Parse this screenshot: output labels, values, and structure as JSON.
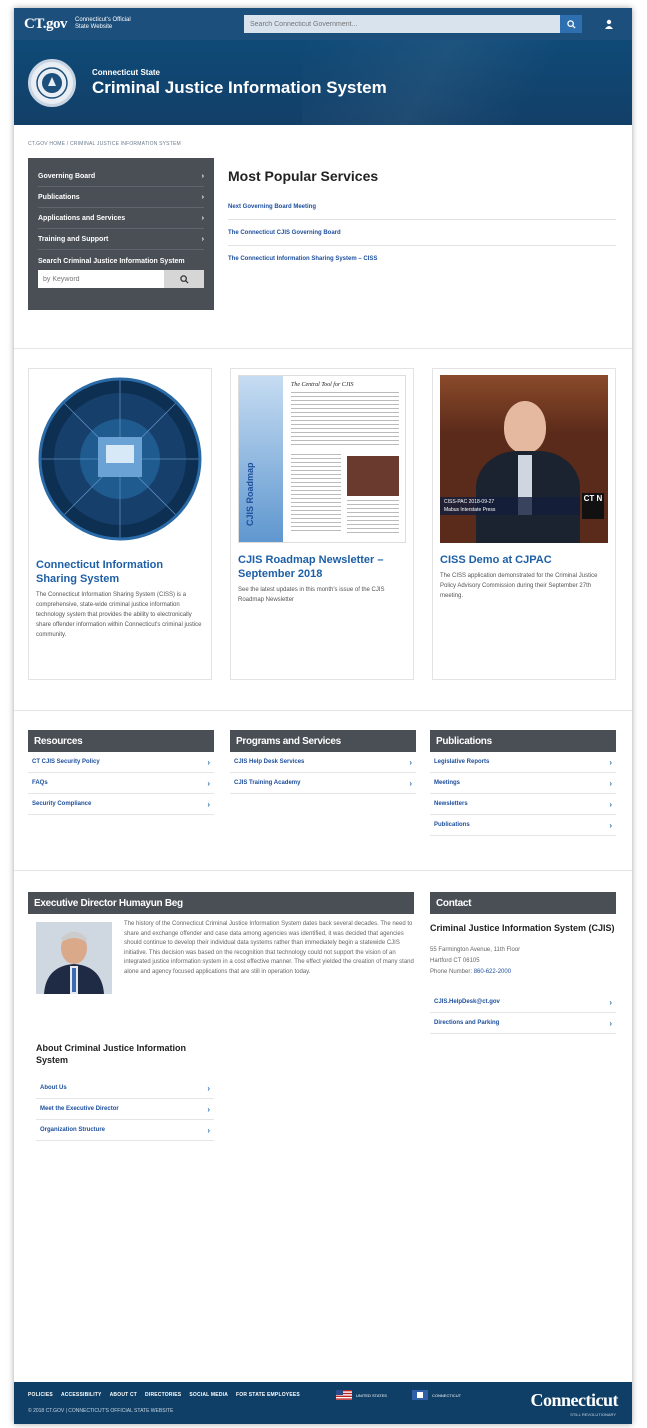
{
  "topbar": {
    "logo": "CT.gov",
    "logo_sub": "Connecticut's Official State Website",
    "search_placeholder": "Search Connecticut Government...",
    "search_icon": "search-icon",
    "user_icon": "user-icon"
  },
  "hero": {
    "agency_small": "Connecticut State",
    "agency_title": "Criminal Justice Information System"
  },
  "breadcrumb": "CT.GOV HOME  /  CRIMINAL JUSTICE INFORMATION SYSTEM",
  "sidebar": {
    "items": [
      {
        "label": "Governing Board",
        "chevron": "›"
      },
      {
        "label": "Publications",
        "chevron": "›"
      },
      {
        "label": "Applications and Services",
        "chevron": "›"
      },
      {
        "label": "Training and Support",
        "chevron": "›"
      }
    ],
    "search_label": "Search Criminal Justice Information System",
    "search_placeholder": "by Keyword",
    "search_icon": "⌕"
  },
  "popular": {
    "title": "Most Popular Services",
    "links": [
      "Next Governing Board Meeting",
      "The Connecticut CJIS Governing Board",
      "The Connecticut Information Sharing System – CISS"
    ]
  },
  "cards": [
    {
      "title": "Connecticut Information Sharing System",
      "text": "The Connecticut Information Sharing System (CISS) is a comprehensive, state-wide criminal justice information technology system that provides the ability to electronically share offender information within Connecticut's criminal justice community."
    },
    {
      "title": "CJIS Roadmap Newsletter – September 2018",
      "text": "See the latest updates in this month's issue of the CJIS Roadmap Newsletter"
    },
    {
      "title": "CISS Demo at CJPAC",
      "text": "The CISS application demonstrated for the Criminal Justice Policy Advisory Commission during their September 27th meeting."
    }
  ],
  "card_images": {
    "newsletter_heading": "The Central Tool for CJIS",
    "newsletter_spine": "CJIS Roadmap",
    "video_caption_1": "CISS-PAC  2018-09-27",
    "video_caption_2": "Mabus Interstate Press",
    "video_badge": "CT N"
  },
  "lists": [
    {
      "head": "Resources",
      "links": [
        "CT CJIS Security Policy",
        "FAQs",
        "Security Compliance"
      ]
    },
    {
      "head": "Programs and Services",
      "links": [
        "CJIS Help Desk Services",
        "CJIS Training Academy"
      ]
    },
    {
      "head": "Publications",
      "links": [
        "Legislative Reports",
        "Meetings",
        "Newsletters",
        "Publications"
      ]
    }
  ],
  "executive": {
    "head": "Executive Director Humayun Beg",
    "text": "The history of the Connecticut Criminal Justice Information System dates back several decades. The need to share and exchange offender and case data among agencies was identified, it was decided that agencies should continue to develop their individual data systems rather than immediately begin a statewide CJIS initiative. This decision was based on the recognition that technology could not support the vision of an integrated justice information system in a cost effective manner. The effect yielded the creation of many stand alone and agency focused applications that are still in operation today.",
    "about_title": "About Criminal Justice Information System",
    "about_links": [
      "About Us",
      "Meet the Executive Director",
      "Organization Structure"
    ]
  },
  "contact": {
    "head": "Contact",
    "title": "Criminal Justice Information System (CJIS)",
    "address_1": "55 Farmington Avenue, 11th Floor",
    "address_2": "Hartford CT 06105",
    "phone_label": "Phone Number:",
    "phone": "860-622-2000",
    "links": [
      "CJIS.HelpDesk@ct.gov",
      "Directions and Parking"
    ]
  },
  "footer": {
    "links": [
      "POLICIES",
      "ACCESSIBILITY",
      "ABOUT CT",
      "DIRECTORIES",
      "SOCIAL MEDIA",
      "FOR STATE EMPLOYEES"
    ],
    "badge_us": "UNITED STATES",
    "badge_ct": "CONNECTICUT",
    "copyright": "© 2018 CT.GOV | CONNECTICUT'S OFFICIAL STATE WEBSITE",
    "logo": "Connecticut",
    "tagline": "STILL REVOLUTIONARY"
  },
  "colors": {
    "brand_blue": "#1d4f7c",
    "nav_gray": "#4a4f56",
    "link_blue": "#1d4f9c"
  }
}
